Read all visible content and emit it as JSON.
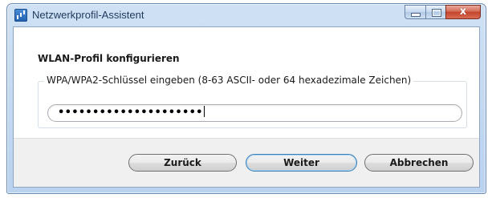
{
  "window": {
    "title": "Netzwerkprofil-Assistent",
    "app_icon": "wifi-signal-icon",
    "caption_buttons": {
      "minimize": "minimize-icon",
      "maximize": "maximize-icon",
      "close_glyph": "x"
    }
  },
  "page": {
    "heading": "WLAN-Profil konfigurieren",
    "group_label": "WPA/WPA2-Schlüssel eingeben (8-63 ASCII- oder 64 hexadezimale Zeichen)",
    "password_masked": "•••••••••••••••••••••"
  },
  "buttons": {
    "back": "Zurück",
    "next": "Weiter",
    "cancel": "Abbrechen"
  },
  "colors": {
    "title_text": "#1e395b",
    "frame": "#b9d2ee",
    "close_button": "#c4432b",
    "default_button_border": "#3c7fb1"
  }
}
